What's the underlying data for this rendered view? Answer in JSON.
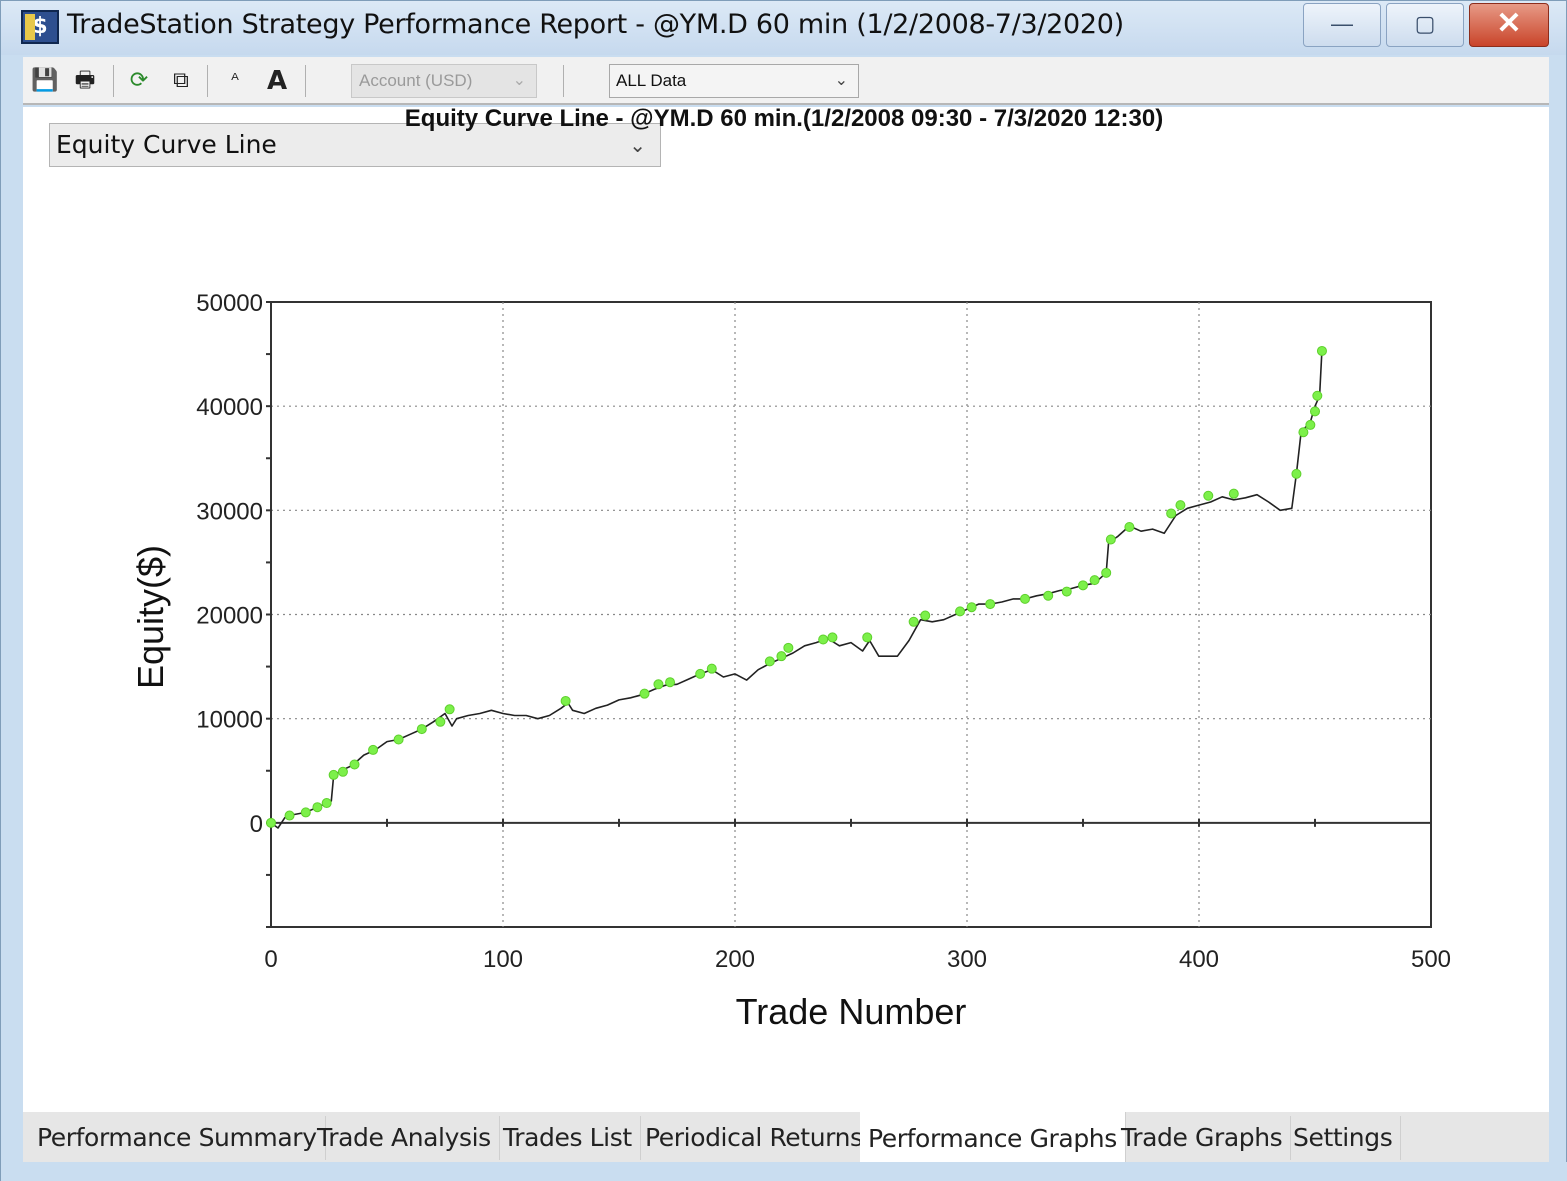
{
  "window": {
    "title": "TradeStation Strategy Performance Report - @YM.D 60 min (1/2/2008-7/3/2020)",
    "icon": "tradestation-app-icon",
    "controls": {
      "minimize": "—",
      "maximize": "▢",
      "close": "✕"
    }
  },
  "toolbar": {
    "icons": [
      "save-icon",
      "print-icon",
      "refresh-icon",
      "export-icon",
      "font-decrease-icon",
      "font-increase-icon"
    ],
    "save_glyph": "💾",
    "print_glyph": "🖶",
    "refresh_glyph": "⟳",
    "export_glyph": "⧉",
    "font_small_glyph": "ᴬ",
    "font_large_glyph": "A",
    "account_select": "Account (USD)",
    "data_select": "ALL Data",
    "chevron": "⌄"
  },
  "graph_select": {
    "value": "Equity Curve Line"
  },
  "chart_title": "Equity Curve Line - @YM.D 60 min.(1/2/2008 09:30 - 7/3/2020 12:30)",
  "chart_data": {
    "type": "line",
    "title": "Equity Curve Line - @YM.D 60 min.(1/2/2008 09:30 - 7/3/2020 12:30)",
    "xlabel": "Trade Number",
    "ylabel": "Equity($)",
    "xlim": [
      0,
      500
    ],
    "ylim": [
      -10000,
      50000
    ],
    "xticks": [
      "0",
      "100",
      "200",
      "300",
      "400",
      "500"
    ],
    "yticks": [
      "0",
      "10000",
      "20000",
      "30000",
      "40000",
      "50000"
    ],
    "grid": true,
    "line_color": "#222222",
    "marker_color": "#7cf04a",
    "series": [
      {
        "x": [
          0,
          3,
          6,
          10,
          15,
          20,
          25,
          26,
          27,
          30,
          35,
          40,
          45,
          50,
          55,
          60,
          65,
          70,
          75,
          78,
          80,
          85,
          90,
          95,
          100,
          105,
          110,
          115,
          120,
          125,
          128,
          130,
          135,
          140,
          145,
          150,
          155,
          160,
          165,
          170,
          175,
          180,
          185,
          190,
          195,
          200,
          205,
          210,
          215,
          220,
          225,
          230,
          235,
          240,
          245,
          250,
          255,
          258,
          262,
          270,
          275,
          280,
          285,
          290,
          295,
          300,
          305,
          310,
          315,
          320,
          325,
          330,
          335,
          340,
          345,
          350,
          355,
          360,
          361,
          363,
          365,
          370,
          375,
          380,
          385,
          390,
          395,
          400,
          405,
          410,
          415,
          420,
          425,
          430,
          435,
          440,
          442,
          444,
          446,
          448,
          450,
          452,
          453
        ],
        "y": [
          0,
          -500,
          500,
          800,
          1000,
          1500,
          2000,
          2100,
          4500,
          5000,
          5500,
          6500,
          7000,
          7800,
          8000,
          8500,
          9000,
          9700,
          10500,
          9300,
          10000,
          10300,
          10500,
          10800,
          10500,
          10300,
          10300,
          10000,
          10300,
          11000,
          11500,
          10800,
          10500,
          11000,
          11300,
          11800,
          12000,
          12300,
          12800,
          13200,
          13300,
          13800,
          14300,
          14700,
          14000,
          14300,
          13700,
          14700,
          15300,
          15800,
          16300,
          17000,
          17300,
          17700,
          17000,
          17300,
          16500,
          17500,
          16000,
          16000,
          17500,
          19500,
          19300,
          19500,
          20000,
          20500,
          21000,
          21000,
          21200,
          21500,
          21500,
          21800,
          22000,
          22300,
          22500,
          22800,
          23000,
          24000,
          26800,
          27200,
          27500,
          28500,
          28000,
          28200,
          27800,
          29500,
          30200,
          30500,
          30800,
          31300,
          31000,
          31200,
          31500,
          30800,
          30000,
          30200,
          33500,
          37500,
          38000,
          38500,
          40000,
          41000,
          45500
        ],
        "markers": [
          [
            0,
            0
          ],
          [
            8,
            700
          ],
          [
            15,
            1000
          ],
          [
            20,
            1500
          ],
          [
            24,
            1900
          ],
          [
            27,
            4600
          ],
          [
            31,
            4900
          ],
          [
            36,
            5600
          ],
          [
            44,
            7000
          ],
          [
            55,
            8000
          ],
          [
            65,
            9000
          ],
          [
            73,
            9700
          ],
          [
            77,
            10900
          ],
          [
            127,
            11700
          ],
          [
            161,
            12400
          ],
          [
            167,
            13300
          ],
          [
            172,
            13500
          ],
          [
            185,
            14300
          ],
          [
            190,
            14800
          ],
          [
            215,
            15500
          ],
          [
            220,
            16000
          ],
          [
            223,
            16800
          ],
          [
            238,
            17600
          ],
          [
            242,
            17800
          ],
          [
            257,
            17800
          ],
          [
            277,
            19300
          ],
          [
            282,
            19900
          ],
          [
            297,
            20300
          ],
          [
            302,
            20700
          ],
          [
            310,
            21000
          ],
          [
            325,
            21500
          ],
          [
            335,
            21800
          ],
          [
            343,
            22200
          ],
          [
            350,
            22800
          ],
          [
            355,
            23300
          ],
          [
            360,
            24000
          ],
          [
            362,
            27200
          ],
          [
            370,
            28400
          ],
          [
            388,
            29700
          ],
          [
            392,
            30500
          ],
          [
            404,
            31400
          ],
          [
            415,
            31600
          ],
          [
            442,
            33500
          ],
          [
            445,
            37500
          ],
          [
            448,
            38200
          ],
          [
            450,
            39500
          ],
          [
            451,
            41000
          ],
          [
            453,
            45300
          ]
        ]
      }
    ]
  },
  "tabs": [
    {
      "label": "Performance Summary"
    },
    {
      "label": "Trade Analysis"
    },
    {
      "label": "Trades List"
    },
    {
      "label": "Periodical Returns"
    },
    {
      "label": "Performance Graphs",
      "active": true
    },
    {
      "label": "Trade Graphs"
    },
    {
      "label": "Settings"
    }
  ]
}
